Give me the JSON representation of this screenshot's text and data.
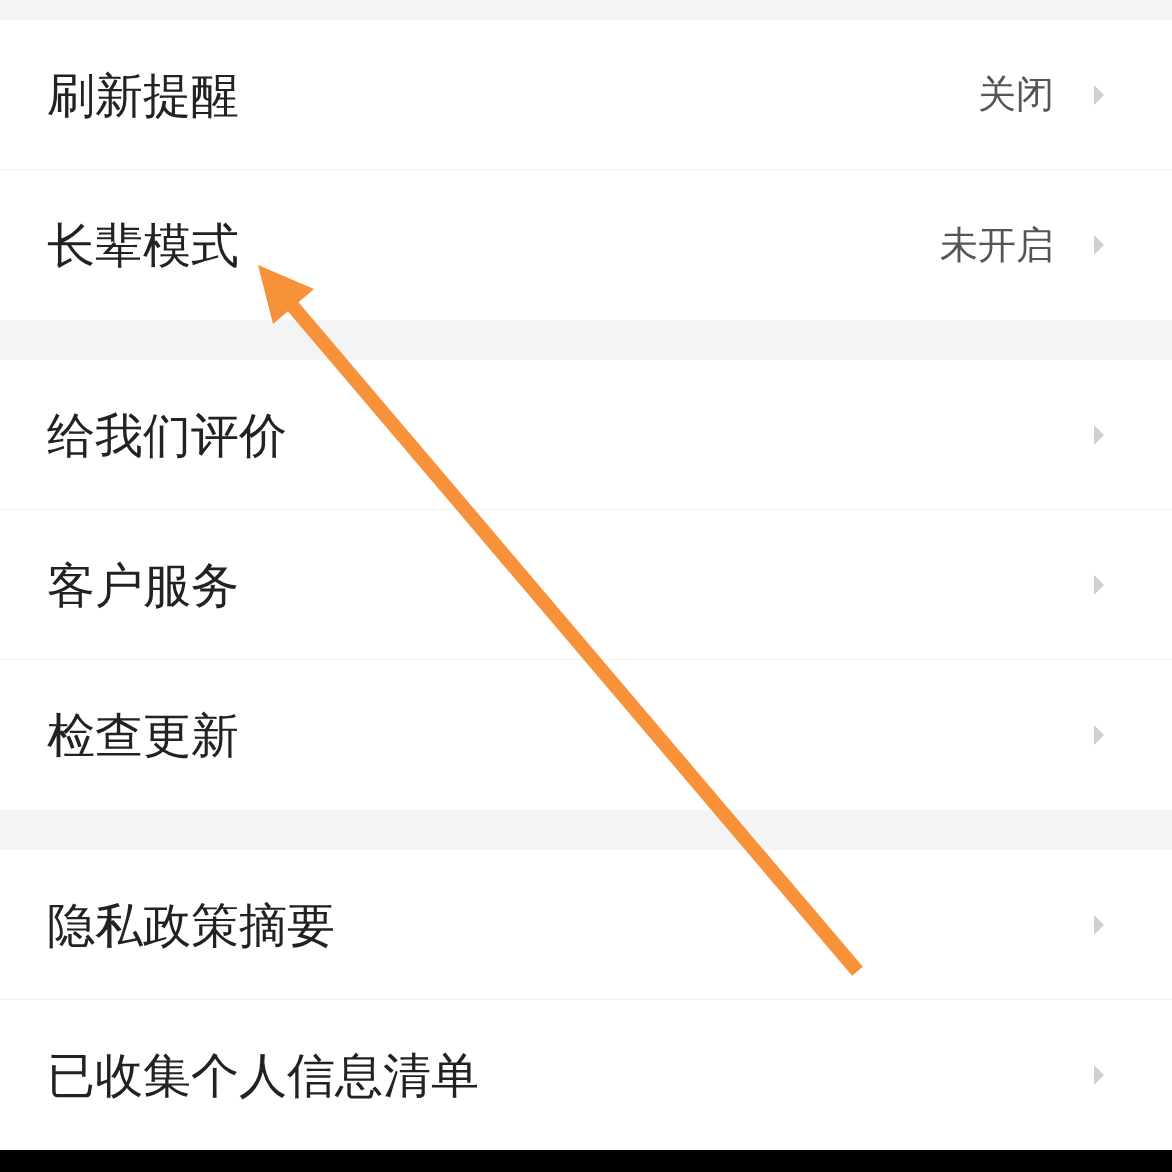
{
  "groups": [
    {
      "items": [
        {
          "label": "刷新提醒",
          "value": "关闭"
        },
        {
          "label": "长辈模式",
          "value": "未开启"
        }
      ]
    },
    {
      "items": [
        {
          "label": "给我们评价"
        },
        {
          "label": "客户服务"
        },
        {
          "label": "检查更新"
        }
      ]
    },
    {
      "items": [
        {
          "label": "隐私政策摘要"
        },
        {
          "label": "已收集个人信息清单"
        }
      ]
    }
  ]
}
